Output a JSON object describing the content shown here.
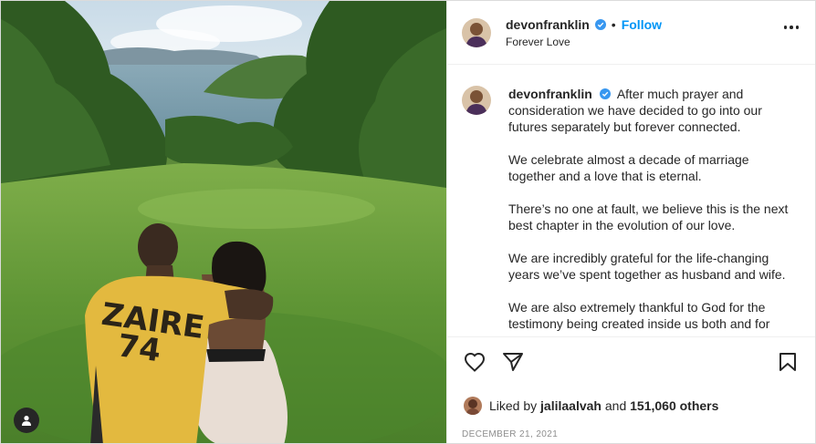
{
  "post": {
    "author": "devonfranklin",
    "verified": true,
    "follow_label": "Follow",
    "separator": "•",
    "location": "Forever Love",
    "caption_lines": [
      "After much prayer and consideration we have decided to go into our futures separately but forever connected.",
      "We celebrate almost a decade of marriage together and a love that is eternal.",
      "There’s no one at fault, we believe this is the next best chapter in the evolution of our love.",
      "We are incredibly grateful for the life-changing years we’ve spent together as husband and wife.",
      "We are also extremely thankful to God for the testimony being created inside us both and for"
    ],
    "liked_prefix": "Liked by",
    "liked_user": "jalilaalvah",
    "liked_and": "and",
    "liked_count": "151,060 others",
    "date": "DECEMBER 21, 2021"
  },
  "photo": {
    "shirt_text_line1": "ZAIRE",
    "shirt_text_line2": "74"
  },
  "icons": {
    "user_tag": "user-tag-icon",
    "more": "more-options-icon",
    "like": "heart-icon",
    "share": "paper-plane-icon",
    "save": "bookmark-icon",
    "verified": "verified-badge-icon"
  },
  "colors": {
    "accent": "#0095f6",
    "verified": "#3897f0",
    "text": "#262626",
    "muted": "#8e8e8e",
    "border": "#efefef"
  }
}
